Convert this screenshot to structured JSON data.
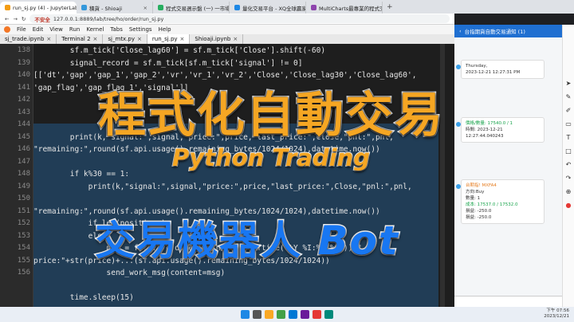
{
  "browser": {
    "tabs": [
      {
        "label": "run_sj.py (4) - JupyterLab",
        "active": true
      },
      {
        "label": "積貨 - Shioaji",
        "active": false
      },
      {
        "label": "程式交易週示盤 (一) 一市場運…",
        "active": false
      },
      {
        "label": "量化交易平台 - XQ全球贏家",
        "active": false
      },
      {
        "label": "MultiCharts最專業的程式交易…",
        "active": false
      }
    ],
    "new_tab": "+",
    "security_label": "不安全",
    "url": "127.0.0.1:8889/lab/tree/ho/order/run_sj.py"
  },
  "jupyter": {
    "menu": [
      "File",
      "Edit",
      "View",
      "Run",
      "Kernel",
      "Tabs",
      "Settings",
      "Help"
    ],
    "file_tabs": [
      {
        "label": "sj_trade.ipynb",
        "active": false
      },
      {
        "label": "Terminal 2",
        "active": false
      },
      {
        "label": "sj_mtx.py",
        "active": false
      },
      {
        "label": "run_sj.py",
        "active": true
      },
      {
        "label": "Shioaji.ipynb",
        "active": false
      }
    ]
  },
  "editor": {
    "line_numbers": [
      "138",
      "139",
      "140",
      "141",
      "142",
      "143",
      "144",
      "145",
      "146",
      "147",
      "148",
      "149",
      "150",
      "151",
      "152",
      "153",
      "154",
      "155",
      "156"
    ],
    "code_lines": [
      "        sf.m_tick['Close_lag60'] = sf.m_tick['Close'].shift(-60)",
      "        signal_record = sf.m_tick[sf.m_tick['signal'] != 0]",
      "[['dt','gap','gap_1','gap_2','vr','vr_1','vr_2','Close','Close_lag30','Close_lag60',",
      "'gap_flag','gap_flag_1','signal']]",
      "",
      "",
      "",
      "        print(k,\"signal:\",signal,\"price:\",price,\"last_price:\",Close,\"pnl:\",pnl,",
      "\"remaining:\",round(sf.api.usage().remaining_bytes/1024/1024),datetime.now())",
      "",
      "        if k%30 == 1:",
      "            print(k,\"signal:\",signal,\"price:\",price,\"last_price:\",Close,\"pnl:\",pnl,",
      "",
      "\"remaining:\",round(sf.api.usage().remaining_bytes/1024/1024),datetime.now())",
      "            if len(positions)",
      "            else:",
      "                msg = f\"...\" + datetime.now().strftime(\"%Y %I:%M:%S\"))+\"",
      "price:\"+str(price)+...(sf.api.usage().remaining_bytes/1024/1024))",
      "                send_work_msg(content=msg)",
      "",
      "        time.sleep(15)"
    ]
  },
  "phone": {
    "header": "台指期貨自動交易通知 (1)",
    "messages": [
      {
        "lines": [
          "Thursday,",
          "2023-12-21 12:27:31 PM"
        ]
      },
      {
        "lines": [
          "價格/數量: 17540.0 / 1",
          "時間: 2023-12-21",
          "12:27:44.040243"
        ]
      },
      {
        "lines": [
          "台期指! MXFA4",
          "方向:Buy",
          "數量: 1",
          "成本: 17537.0 / 17532.0",
          "損益: -250.0",
          "損益: -250.0"
        ]
      }
    ]
  },
  "taskbar": {
    "time": "下午 07:56",
    "date": "2023/12/21"
  },
  "overlay": {
    "main_title": "程式化自動交易",
    "subtitle": "Python Trading",
    "bot_title_cn": "交易機器人",
    "bot_title_en": "Bot"
  },
  "colors": {
    "title_orange": "#f5a623",
    "bot_blue": "#1877f2",
    "editor_bg": "#1e1e1e",
    "selection": "#21405c"
  }
}
